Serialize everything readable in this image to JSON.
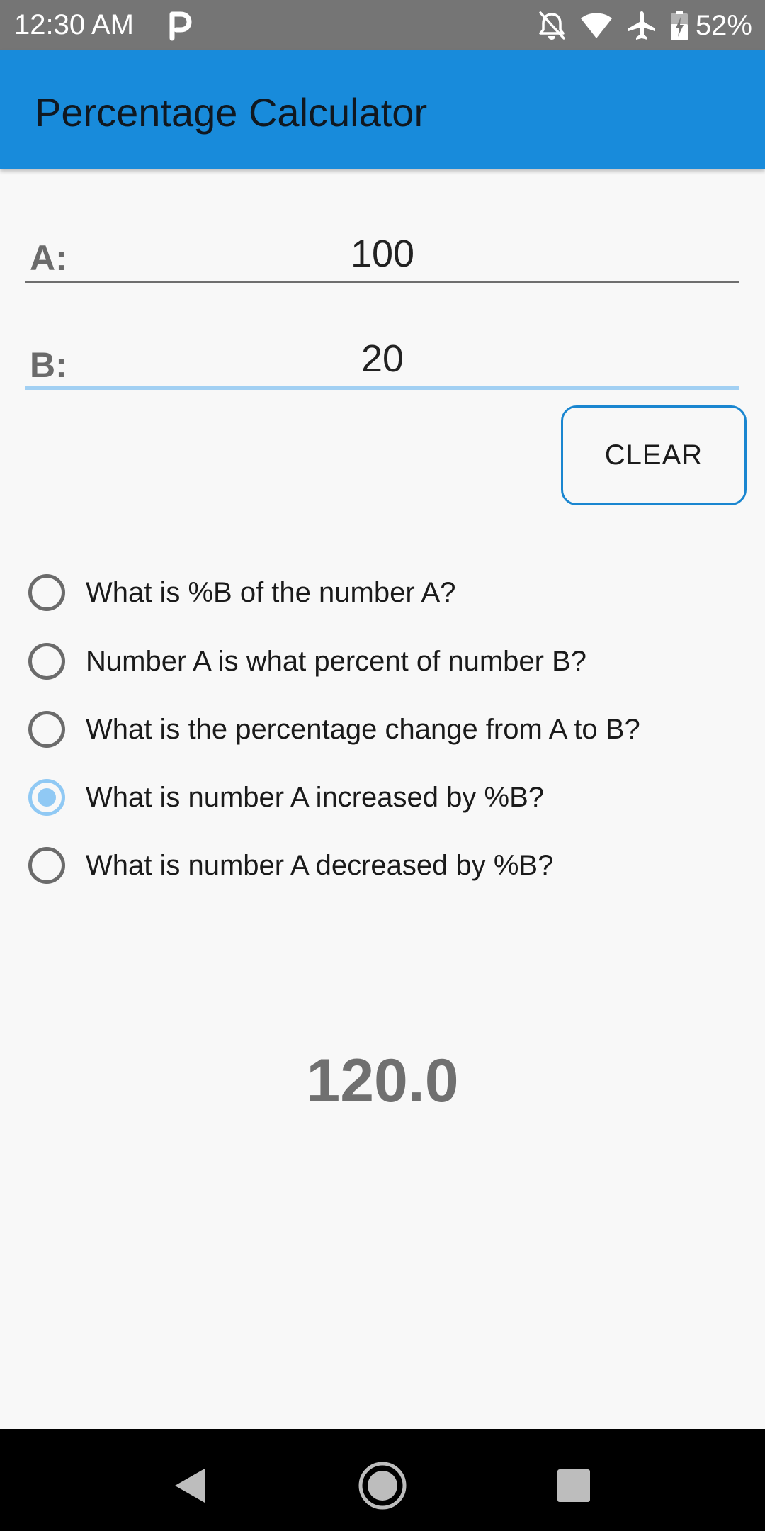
{
  "status_bar": {
    "time": "12:30 AM",
    "battery_percent": "52%",
    "icons": [
      "parking-icon",
      "notifications-off-icon",
      "wifi-icon",
      "airplane-mode-icon",
      "battery-charging-icon"
    ]
  },
  "app_bar": {
    "title": "Percentage Calculator"
  },
  "form": {
    "a_label": "A:",
    "a_value": "100",
    "b_label": "B:",
    "b_value": "20",
    "clear_label": "CLEAR"
  },
  "options": [
    {
      "label": "What is %B of the number A?",
      "checked": false
    },
    {
      "label": "Number A is what percent of number B?",
      "checked": false
    },
    {
      "label": "What is the percentage change from A to B?",
      "checked": false
    },
    {
      "label": "What is number A increased by %B?",
      "checked": true
    },
    {
      "label": "What is number A decreased by %B?",
      "checked": false
    }
  ],
  "result": "120.0",
  "nav_bar": {
    "icons": [
      "back-icon",
      "home-icon",
      "recents-icon"
    ]
  },
  "colors": {
    "status_bar": "#757575",
    "app_bar": "#188bdb",
    "accent_light": "#90c9f4",
    "button_border": "#1a86d0",
    "background": "#f8f8f8"
  }
}
